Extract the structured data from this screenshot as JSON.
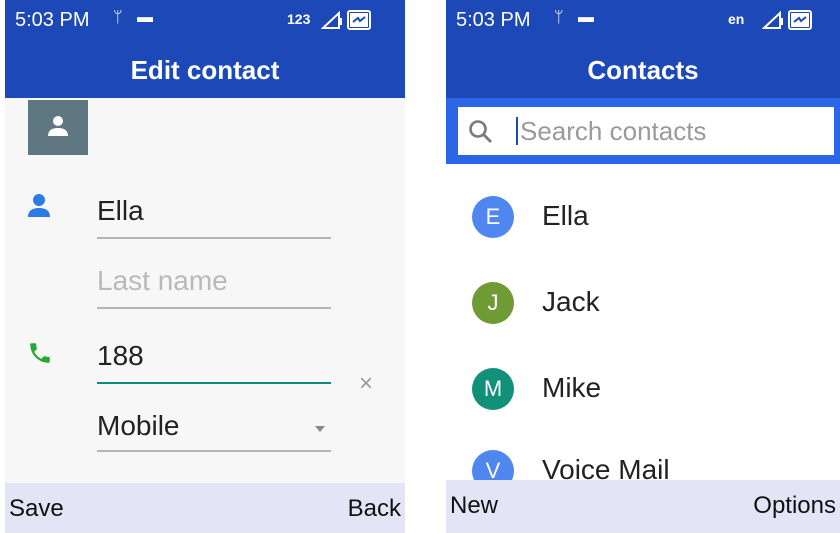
{
  "edit_screen": {
    "status": {
      "time": "5:03 PM",
      "input_mode": "123"
    },
    "title": "Edit contact",
    "fields": {
      "first_name": {
        "value": "Ella"
      },
      "last_name": {
        "placeholder": "Last name"
      },
      "phone": {
        "value": "188"
      },
      "phone_type": {
        "value": "Mobile"
      }
    },
    "softkeys": {
      "left": "Save",
      "right": "Back"
    }
  },
  "contacts_screen": {
    "status": {
      "time": "5:03 PM",
      "input_mode": "en"
    },
    "title": "Contacts",
    "search": {
      "placeholder": "Search contacts"
    },
    "contacts": [
      {
        "initial": "E",
        "name": "Ella",
        "color": "#4f86f0"
      },
      {
        "initial": "J",
        "name": "Jack",
        "color": "#6f9a34"
      },
      {
        "initial": "M",
        "name": "Mike",
        "color": "#11907a"
      },
      {
        "initial": "V",
        "name": "Voice Mail",
        "color": "#4f86f0"
      }
    ],
    "softkeys": {
      "left": "New",
      "right": "Options"
    }
  },
  "colors": {
    "header": "#1d49b8",
    "search_bar": "#2a66e6",
    "softkey_bar": "#e3e4f5",
    "active_underline": "#0e8a7e"
  },
  "icons": [
    "contact-avatar-icon",
    "person-icon",
    "phone-icon",
    "clear-icon",
    "search-icon",
    "signal-icon",
    "battery-charging-icon",
    "usb-icon",
    "sim-icon"
  ]
}
